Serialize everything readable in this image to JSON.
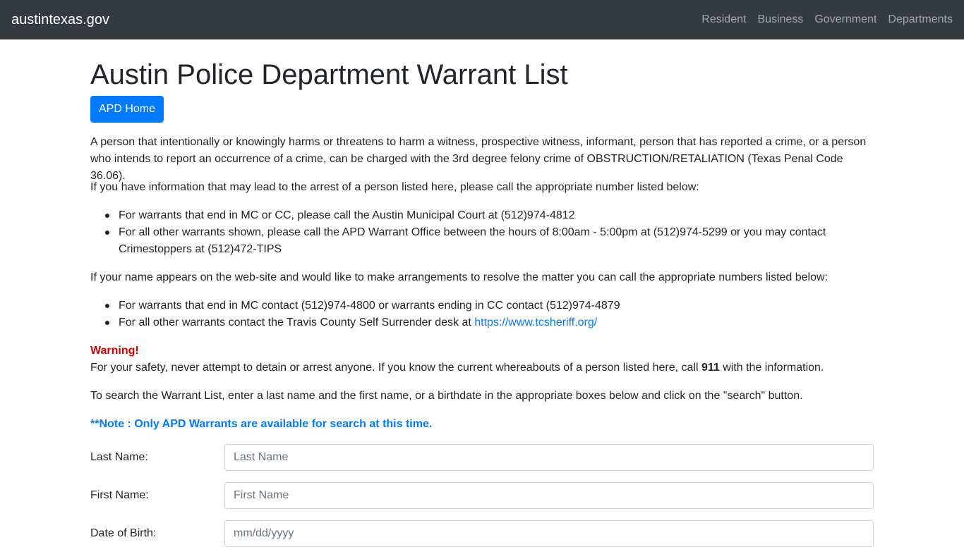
{
  "nav": {
    "brand": "austintexas.gov",
    "links": [
      "Resident",
      "Business",
      "Government",
      "Departments"
    ]
  },
  "page": {
    "title": "Austin Police Department Warrant List",
    "home_button": "APD Home",
    "intro": "A person that intentionally or knowingly harms or threatens to harm a witness, prospective witness, informant, person that has reported a crime, or a person who intends to report an occurrence of a crime, can be charged with the 3rd degree felony crime of OBSTRUCTION/RETALIATION (Texas Penal Code 36.06).",
    "info_lead": "If you have information that may lead to the arrest of a person listed here, please call the appropriate number listed below:",
    "info_items": [
      "For warrants that end in MC or CC, please call the Austin Municipal Court at (512)974-4812",
      "For all other warrants shown, please call the APD Warrant Office between the hours of 8:00am - 5:00pm at (512)974-5299 or you may contact Crimestoppers at (512)472-TIPS"
    ],
    "resolve_lead": "If your name appears on the web-site and would like to make arrangements to resolve the matter you can call the appropriate numbers listed below:",
    "resolve_item_1": "For warrants that end in MC contact (512)974-4800 or warrants ending in CC contact (512)974-4879",
    "resolve_item_2_prefix": "For all other warrants contact the Travis County Self Surrender desk at ",
    "resolve_item_2_link": "https://www.tcsheriff.org/",
    "warning_label": "Warning!",
    "warning_text_before": "For your safety, never attempt to detain or arrest anyone. If you know the current whereabouts of a person listed here, call ",
    "warning_number": "911",
    "warning_text_after": " with the information.",
    "search_instructions": "To search the Warrant List, enter a last name and the first name, or a birthdate in the appropriate boxes below and click on the \"search\" button.",
    "note": "**Note : Only APD Warrants are available for search at this time."
  },
  "form": {
    "last_name_label": "Last Name:",
    "last_name_placeholder": "Last Name",
    "first_name_label": "First Name:",
    "first_name_placeholder": "First Name",
    "dob_label": "Date of Birth:",
    "dob_placeholder": "mm/dd/yyyy"
  },
  "colors": {
    "navbar": "#343a40",
    "primary": "#007bff",
    "warning": "#d40000"
  }
}
